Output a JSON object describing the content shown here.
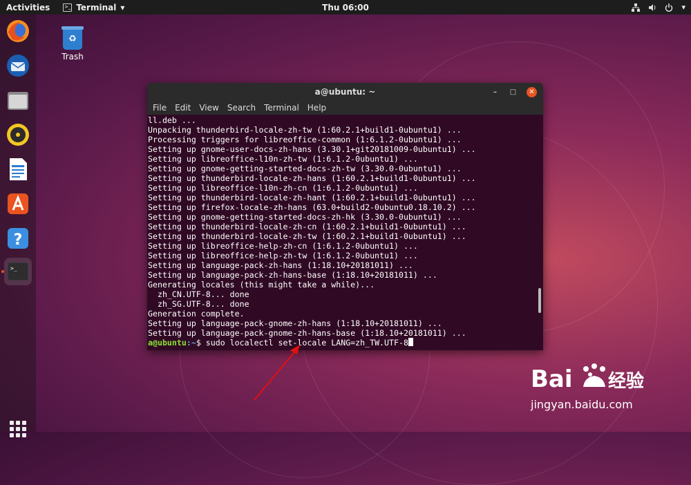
{
  "topbar": {
    "activities": "Activities",
    "app_name": "Terminal",
    "app_menu_arrow": "▾",
    "clock": "Thu 06:00",
    "tray_icons": [
      "network-icon",
      "volume-icon",
      "power-icon"
    ]
  },
  "dock": {
    "items": [
      "firefox",
      "thunderbird",
      "files",
      "rhythmbox",
      "libreoffice-writer",
      "ubuntu-software",
      "help",
      "terminal"
    ],
    "active": "terminal"
  },
  "desktop": {
    "trash_label": "Trash"
  },
  "terminal": {
    "title": "a@ubuntu: ~",
    "menu": [
      "File",
      "Edit",
      "View",
      "Search",
      "Terminal",
      "Help"
    ],
    "lines": [
      "ll.deb ...",
      "Unpacking thunderbird-locale-zh-tw (1:60.2.1+build1-0ubuntu1) ...",
      "Processing triggers for libreoffice-common (1:6.1.2-0ubuntu1) ...",
      "Setting up gnome-user-docs-zh-hans (3.30.1+git20181009-0ubuntu1) ...",
      "Setting up libreoffice-l10n-zh-tw (1:6.1.2-0ubuntu1) ...",
      "Setting up gnome-getting-started-docs-zh-tw (3.30.0-0ubuntu1) ...",
      "Setting up thunderbird-locale-zh-hans (1:60.2.1+build1-0ubuntu1) ...",
      "Setting up libreoffice-l10n-zh-cn (1:6.1.2-0ubuntu1) ...",
      "Setting up thunderbird-locale-zh-hant (1:60.2.1+build1-0ubuntu1) ...",
      "Setting up firefox-locale-zh-hans (63.0+build2-0ubuntu0.18.10.2) ...",
      "Setting up gnome-getting-started-docs-zh-hk (3.30.0-0ubuntu1) ...",
      "Setting up thunderbird-locale-zh-cn (1:60.2.1+build1-0ubuntu1) ...",
      "Setting up thunderbird-locale-zh-tw (1:60.2.1+build1-0ubuntu1) ...",
      "Setting up libreoffice-help-zh-cn (1:6.1.2-0ubuntu1) ...",
      "Setting up libreoffice-help-zh-tw (1:6.1.2-0ubuntu1) ...",
      "Setting up language-pack-zh-hans (1:18.10+20181011) ...",
      "Setting up language-pack-zh-hans-base (1:18.10+20181011) ...",
      "Generating locales (this might take a while)...",
      "  zh_CN.UTF-8... done",
      "  zh_SG.UTF-8... done",
      "Generation complete.",
      "Setting up language-pack-gnome-zh-hans (1:18.10+20181011) ...",
      "Setting up language-pack-gnome-zh-hans-base (1:18.10+20181011) ..."
    ],
    "prompt_user": "a@ubuntu",
    "prompt_path": ":~",
    "prompt_symbol": "$ ",
    "command": "sudo localectl set-locale LANG=zh_TW.UTF-8"
  },
  "watermark": {
    "logo": "Bai du 经验",
    "url": "jingyan.baidu.com"
  },
  "colors": {
    "terminal_bg": "#300a24",
    "prompt_user": "#8ae234",
    "prompt_path": "#729fcf",
    "close_button": "#e95420"
  }
}
